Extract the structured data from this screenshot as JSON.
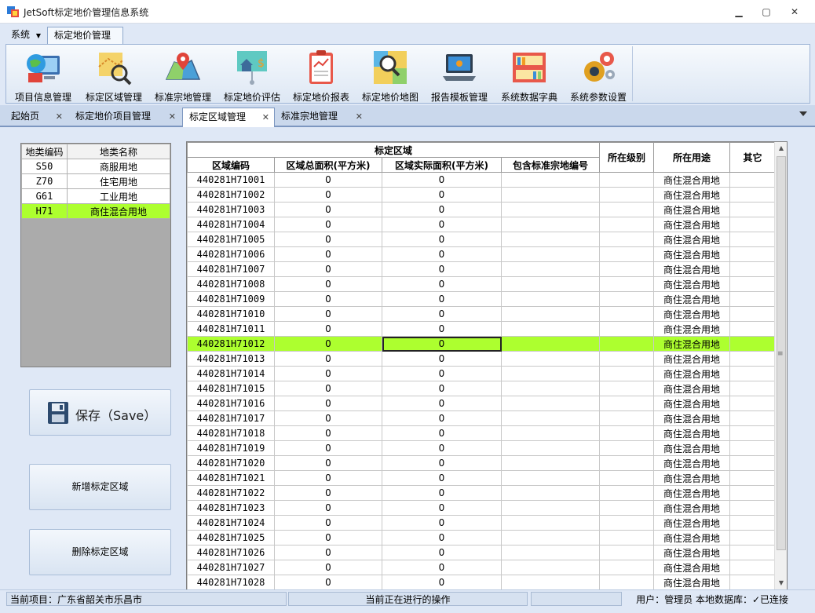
{
  "window": {
    "title": "JetSoft标定地价管理信息系统",
    "minimize": "▁",
    "maximize": "▢",
    "close": "✕"
  },
  "ribbon_tabs": [
    {
      "label": "系统"
    },
    {
      "label": "标定地价管理"
    }
  ],
  "ribbon_buttons": [
    {
      "label": "项目信息管理",
      "icon": "computer-globe-icon"
    },
    {
      "label": "标定区域管理",
      "icon": "map-search-icon"
    },
    {
      "label": "标准宗地管理",
      "icon": "map-pin-icon"
    },
    {
      "label": "标定地价评估",
      "icon": "house-price-icon"
    },
    {
      "label": "标定地价报表",
      "icon": "report-clipboard-icon"
    },
    {
      "label": "标定地价地图",
      "icon": "map-magnifier-icon"
    },
    {
      "label": "报告模板管理",
      "icon": "laptop-icon"
    },
    {
      "label": "系统数据字典",
      "icon": "bookshelf-icon"
    },
    {
      "label": "系统参数设置",
      "icon": "gears-icon"
    }
  ],
  "doc_tabs": [
    {
      "label": "起始页"
    },
    {
      "label": "标定地价项目管理"
    },
    {
      "label": "标定区域管理"
    },
    {
      "label": "标准宗地管理"
    }
  ],
  "land_types": {
    "headers": [
      "地类编码",
      "地类名称"
    ],
    "rows": [
      {
        "code": "S50",
        "name": "商服用地"
      },
      {
        "code": "Z70",
        "name": "住宅用地"
      },
      {
        "code": "G61",
        "name": "工业用地"
      },
      {
        "code": "H71",
        "name": "商住混合用地"
      }
    ]
  },
  "buttons": {
    "save": "保存（Save）",
    "add": "新增标定区域",
    "delete": "删除标定区域"
  },
  "grid": {
    "group_header": "标定区域",
    "headers": [
      "区域编码",
      "区域总面积(平方米)",
      "区域实际面积(平方米)",
      "包含标准宗地编号",
      "所在级别",
      "所在用途",
      "其它"
    ],
    "rows": [
      {
        "code": "440281H71001",
        "total": "0",
        "actual": "0",
        "usage": "商住混合用地"
      },
      {
        "code": "440281H71002",
        "total": "0",
        "actual": "0",
        "usage": "商住混合用地"
      },
      {
        "code": "440281H71003",
        "total": "0",
        "actual": "0",
        "usage": "商住混合用地"
      },
      {
        "code": "440281H71004",
        "total": "0",
        "actual": "0",
        "usage": "商住混合用地"
      },
      {
        "code": "440281H71005",
        "total": "0",
        "actual": "0",
        "usage": "商住混合用地"
      },
      {
        "code": "440281H71006",
        "total": "0",
        "actual": "0",
        "usage": "商住混合用地"
      },
      {
        "code": "440281H71007",
        "total": "0",
        "actual": "0",
        "usage": "商住混合用地"
      },
      {
        "code": "440281H71008",
        "total": "0",
        "actual": "0",
        "usage": "商住混合用地"
      },
      {
        "code": "440281H71009",
        "total": "0",
        "actual": "0",
        "usage": "商住混合用地"
      },
      {
        "code": "440281H71010",
        "total": "0",
        "actual": "0",
        "usage": "商住混合用地"
      },
      {
        "code": "440281H71011",
        "total": "0",
        "actual": "0",
        "usage": "商住混合用地"
      },
      {
        "code": "440281H71012",
        "total": "0",
        "actual": "0",
        "usage": "商住混合用地"
      },
      {
        "code": "440281H71013",
        "total": "0",
        "actual": "0",
        "usage": "商住混合用地"
      },
      {
        "code": "440281H71014",
        "total": "0",
        "actual": "0",
        "usage": "商住混合用地"
      },
      {
        "code": "440281H71015",
        "total": "0",
        "actual": "0",
        "usage": "商住混合用地"
      },
      {
        "code": "440281H71016",
        "total": "0",
        "actual": "0",
        "usage": "商住混合用地"
      },
      {
        "code": "440281H71017",
        "total": "0",
        "actual": "0",
        "usage": "商住混合用地"
      },
      {
        "code": "440281H71018",
        "total": "0",
        "actual": "0",
        "usage": "商住混合用地"
      },
      {
        "code": "440281H71019",
        "total": "0",
        "actual": "0",
        "usage": "商住混合用地"
      },
      {
        "code": "440281H71020",
        "total": "0",
        "actual": "0",
        "usage": "商住混合用地"
      },
      {
        "code": "440281H71021",
        "total": "0",
        "actual": "0",
        "usage": "商住混合用地"
      },
      {
        "code": "440281H71022",
        "total": "0",
        "actual": "0",
        "usage": "商住混合用地"
      },
      {
        "code": "440281H71023",
        "total": "0",
        "actual": "0",
        "usage": "商住混合用地"
      },
      {
        "code": "440281H71024",
        "total": "0",
        "actual": "0",
        "usage": "商住混合用地"
      },
      {
        "code": "440281H71025",
        "total": "0",
        "actual": "0",
        "usage": "商住混合用地"
      },
      {
        "code": "440281H71026",
        "total": "0",
        "actual": "0",
        "usage": "商住混合用地"
      },
      {
        "code": "440281H71027",
        "total": "0",
        "actual": "0",
        "usage": "商住混合用地"
      },
      {
        "code": "440281H71028",
        "total": "0",
        "actual": "0",
        "usage": "商住混合用地"
      }
    ]
  },
  "status": {
    "project": "当前项目：广东省韶关市乐昌市",
    "operation": "当前正在进行的操作",
    "user": "用户：管理员  本地数据库：✓已连接"
  },
  "colors": {
    "selection": "#adff2f",
    "ribbon_border": "#9fb5d6",
    "background": "#dfe8f6"
  }
}
